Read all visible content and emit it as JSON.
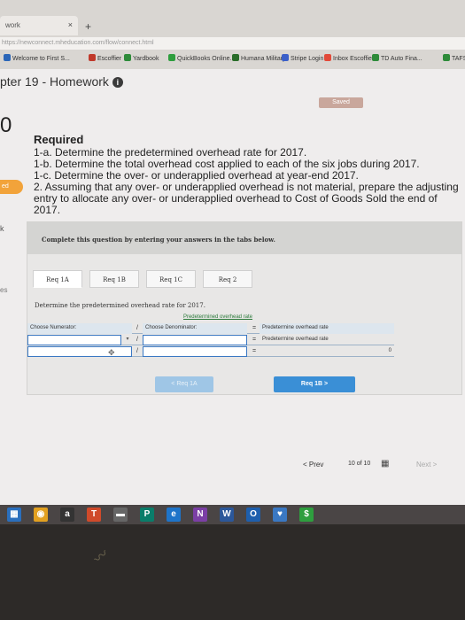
{
  "browser": {
    "tab_label": "work",
    "tab_close": "×",
    "new_tab": "+",
    "url": "https://newconnect.mheducation.com/flow/connect.html",
    "bookmarks": [
      {
        "label": "Welcome to First S...",
        "color": "#2b66b8"
      },
      {
        "label": "Escoffier",
        "color": "#c0392b"
      },
      {
        "label": "Yardbook",
        "color": "#2e8b3a"
      },
      {
        "label": "QuickBooks Online...",
        "color": "#2e9e3e"
      },
      {
        "label": "Humana Military",
        "color": "#2a6d2a"
      },
      {
        "label": "Stripe Login",
        "color": "#3a5fc9"
      },
      {
        "label": "Inbox Escoffier",
        "color": "#e24a3a"
      },
      {
        "label": "TD Auto Fina...",
        "color": "#2e8b3a"
      },
      {
        "label": "TAFS",
        "color": "#2e8b3a"
      }
    ]
  },
  "page": {
    "course_title": "pter 19 - Homework",
    "info_icon": "i",
    "saved_label": "Saved",
    "question_number": "0",
    "side_badge": "ed",
    "side_k": "k",
    "side_es": "es"
  },
  "required": {
    "heading": "Required",
    "items": [
      "1-a. Determine the predetermined overhead rate for 2017.",
      "1-b. Determine the total overhead cost applied to each of the six jobs during 2017.",
      "1-c. Determine the over- or underapplied overhead at year-end 2017.",
      "2. Assuming that any over- or underapplied overhead is not material, prepare the adjusting entry to allocate any over- or underapplied overhead to Cost of Goods Sold the end of 2017."
    ]
  },
  "panel": {
    "header": "Complete this question by entering your answers in the tabs below.",
    "tabs": [
      "Req 1A",
      "Req 1B",
      "Req 1C",
      "Req 2"
    ],
    "active_tab": "Req 1A",
    "instruction": "Determine the predetermined overhead rate for 2017.",
    "table": {
      "title": "Predetermined overhead rate",
      "col_numerator": "Choose Numerator:",
      "divide": "/",
      "col_denominator": "Choose Denominator:",
      "equals": "=",
      "col_result": "Predetermine overhead rate",
      "result_label": "Predetermine overhead rate",
      "result_value": "0",
      "dropdown_caret": "▾"
    },
    "prev_button": "< Req 1A",
    "next_button": "Req 1B  >"
  },
  "pager": {
    "prev": "< Prev",
    "count": "10 of 10",
    "next": "Next >"
  },
  "taskbar": {
    "icons": [
      {
        "name": "start-icon",
        "glyph": "▦",
        "color": "#2a6fbd"
      },
      {
        "name": "chrome-icon",
        "glyph": "◉",
        "color": "#e2a020"
      },
      {
        "name": "amazon-icon",
        "glyph": "a",
        "color": "#333"
      },
      {
        "name": "t-app-icon",
        "glyph": "T",
        "color": "#d04a2a"
      },
      {
        "name": "app-icon",
        "glyph": "▬",
        "color": "#666"
      },
      {
        "name": "publisher-icon",
        "glyph": "P",
        "color": "#0a7d6a"
      },
      {
        "name": "edge-icon",
        "glyph": "e",
        "color": "#1e74c9"
      },
      {
        "name": "onenote-icon",
        "glyph": "N",
        "color": "#7b3fa5"
      },
      {
        "name": "word-icon",
        "glyph": "W",
        "color": "#2b579a"
      },
      {
        "name": "outlook-icon",
        "glyph": "O",
        "color": "#1e5fad"
      },
      {
        "name": "security-icon",
        "glyph": "♥",
        "color": "#3a78c3"
      },
      {
        "name": "money-icon",
        "glyph": "$",
        "color": "#2e9e3e"
      }
    ]
  },
  "colors": {
    "accent": "#3a8fd6",
    "saved": "#c9a79c",
    "badge": "#f2a33a"
  }
}
